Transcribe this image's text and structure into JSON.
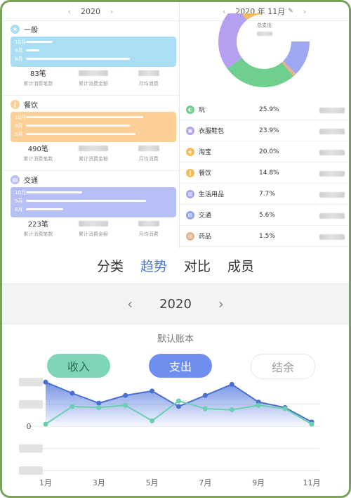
{
  "left_panel": {
    "year": "2020",
    "categories": [
      {
        "name": "一般",
        "icon": "star-icon",
        "color": "#a9def5",
        "months": [
          "10月",
          "9月",
          "8月"
        ],
        "bar_fraction": [
          0.2,
          0.1,
          0.78
        ],
        "count": "83笔",
        "labels": [
          "累计消费笔数",
          "累计消费金额",
          "月均消费"
        ]
      },
      {
        "name": "餐饮",
        "icon": "utensils-icon",
        "color": "#fbcf95",
        "months": [
          "10月",
          "9月",
          "8月"
        ],
        "bar_fraction": [
          0.88,
          0.78,
          0.82
        ],
        "count": "490笔",
        "labels": [
          "累计消费笔数",
          "累计消费金额",
          "月均消费"
        ]
      },
      {
        "name": "交通",
        "icon": "bus-icon",
        "color": "#b7bff7",
        "months": [
          "10月",
          "9月",
          "8月"
        ],
        "bar_fraction": [
          0.42,
          0.9,
          0.28
        ],
        "count": "223笔",
        "labels": [
          "累计消费笔数",
          "累计消费金额",
          "月均消费"
        ]
      }
    ]
  },
  "right_panel": {
    "period": "2020 年 11月",
    "donut_label": "总支出",
    "items": [
      {
        "name": "玩",
        "percent": "25.9%",
        "color": "#6fcf8e",
        "icon": "game-icon"
      },
      {
        "name": "衣服鞋包",
        "percent": "23.9%",
        "color": "#b59ff0",
        "icon": "shirt-icon"
      },
      {
        "name": "淘宝",
        "percent": "20.0%",
        "color": "#f4bd5b",
        "icon": "shop-icon"
      },
      {
        "name": "餐饮",
        "percent": "14.8%",
        "color": "#f4bd5b",
        "icon": "utensils-icon"
      },
      {
        "name": "生活用品",
        "percent": "7.7%",
        "color": "#9ea7f2",
        "icon": "box-icon"
      },
      {
        "name": "交通",
        "percent": "5.6%",
        "color": "#8ea4ec",
        "icon": "bus-icon"
      },
      {
        "name": "药品",
        "percent": "1.5%",
        "color": "#e3b691",
        "icon": "pill-icon"
      }
    ]
  },
  "tabs": [
    {
      "label": "分类",
      "active": false
    },
    {
      "label": "趋势",
      "active": true
    },
    {
      "label": "对比",
      "active": false
    },
    {
      "label": "成员",
      "active": false
    }
  ],
  "year_selector": {
    "value": "2020"
  },
  "book_name": "默认账本",
  "toggle_buttons": [
    {
      "label": "收入",
      "bg": "#7fd6b6",
      "fg": "#2f6b55"
    },
    {
      "label": "支出",
      "bg": "#6f8ff0",
      "fg": "#ffffff"
    },
    {
      "label": "结余",
      "bg": "#ffffff",
      "fg": "#999999"
    }
  ],
  "chart_data": {
    "type": "line",
    "x": [
      "1月",
      "2月",
      "3月",
      "4月",
      "5月",
      "6月",
      "7月",
      "8月",
      "9月",
      "10月",
      "11月"
    ],
    "x_tick_labels": [
      "1月",
      "3月",
      "5月",
      "7月",
      "9月",
      "11月"
    ],
    "y_tick_labels": [
      "0"
    ],
    "series": [
      {
        "key": "expense",
        "color": "#4a6fd0",
        "values": [
          2.0,
          1.5,
          1.05,
          1.4,
          1.6,
          0.9,
          1.4,
          1.9,
          1.1,
          0.85,
          0.2
        ]
      },
      {
        "key": "income",
        "color": "#6ccfb0",
        "values": [
          0.1,
          0.9,
          0.85,
          0.95,
          0.25,
          1.15,
          0.8,
          0.75,
          0.95,
          0.8,
          0.1
        ]
      }
    ],
    "ylim": [
      -2.0,
      2.2
    ],
    "grid": true
  }
}
